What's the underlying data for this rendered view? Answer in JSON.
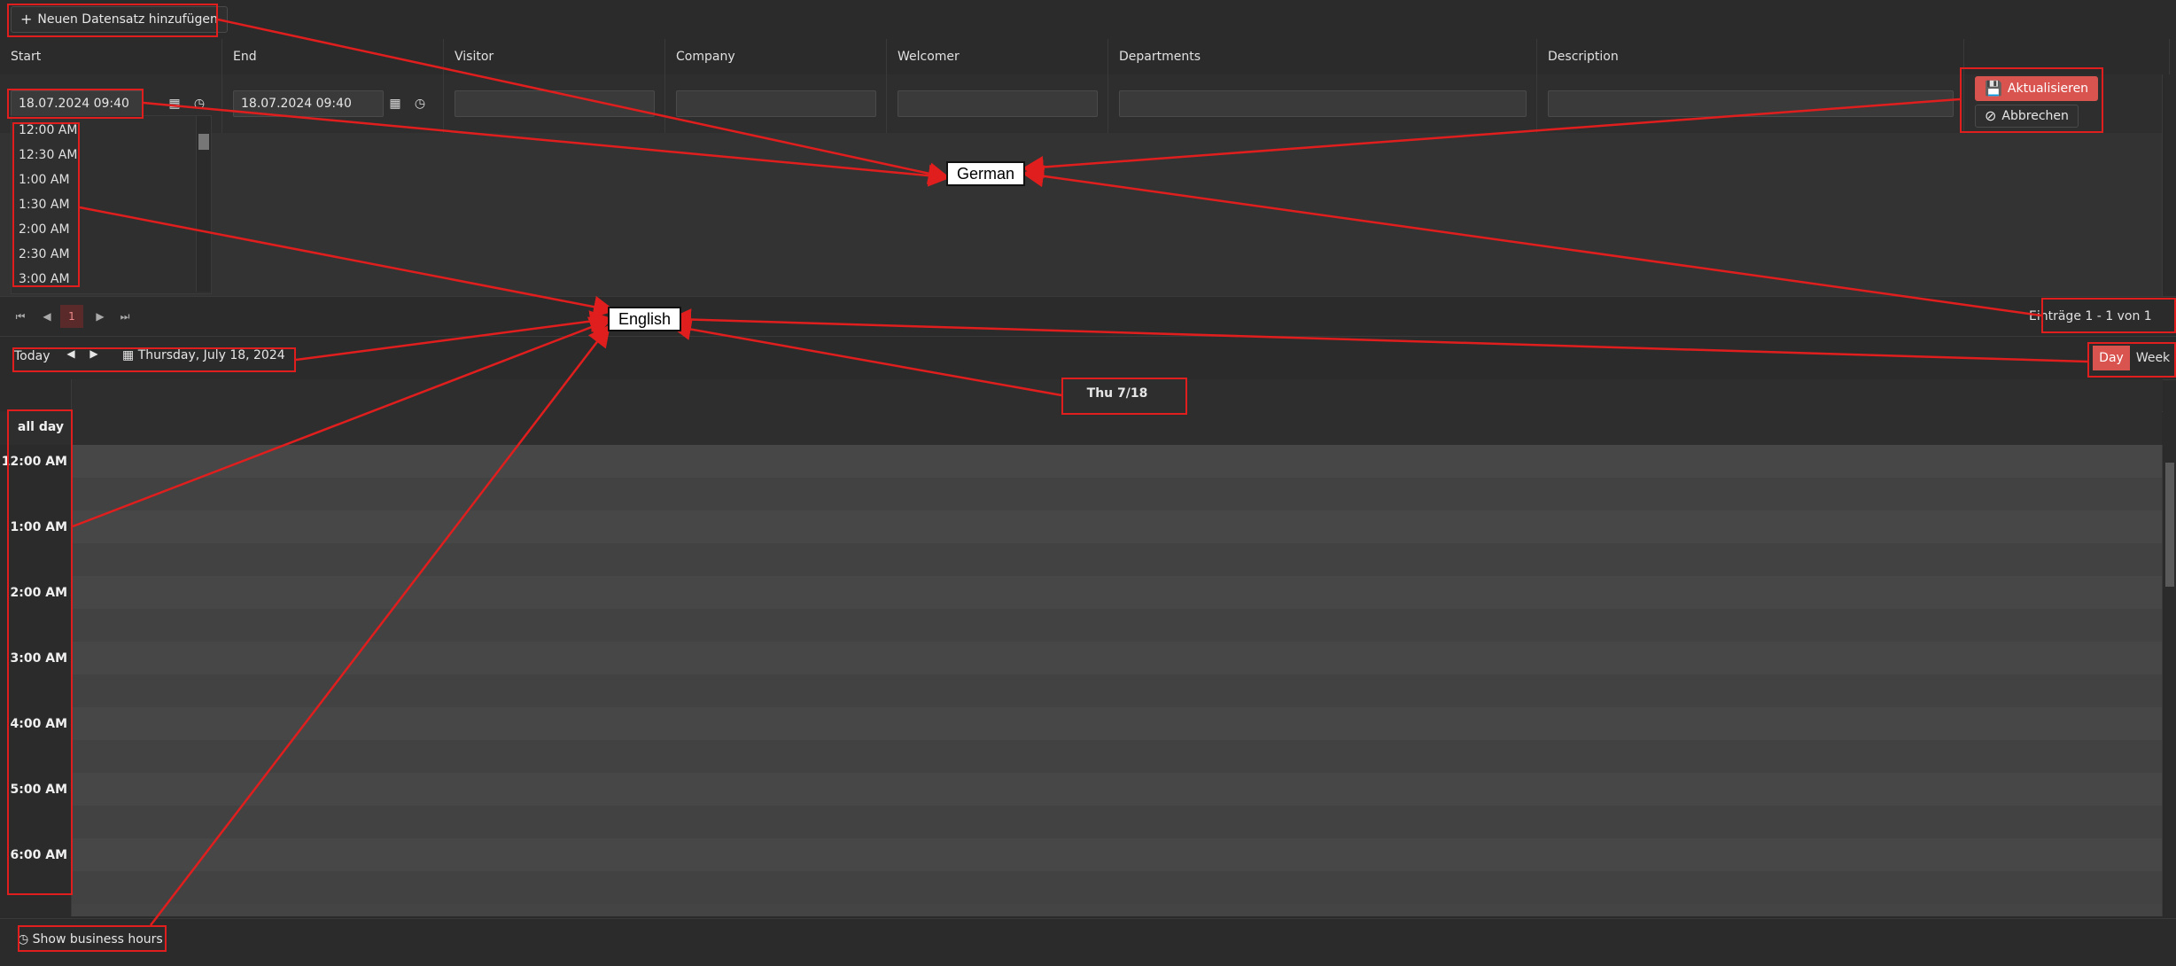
{
  "toolbar": {
    "add_label": "Neuen Datensatz hinzufügen"
  },
  "grid": {
    "columns": [
      "Start",
      "End",
      "Visitor",
      "Company",
      "Welcomer",
      "Departments",
      "Description"
    ],
    "edit_row": {
      "start_value": "18.07.2024 09:40",
      "end_value": "18.07.2024 09:40",
      "update_label": "Aktualisieren",
      "cancel_label": "Abbrechen"
    },
    "time_options": [
      "12:00 AM",
      "12:30 AM",
      "1:00 AM",
      "1:30 AM",
      "2:00 AM",
      "2:30 AM",
      "3:00 AM"
    ],
    "pager": {
      "current_page": "1",
      "summary": "Einträge 1 - 1 von 1"
    }
  },
  "scheduler": {
    "today_label": "Today",
    "date_label": "Thursday, July 18, 2024",
    "views": [
      "Day",
      "Week"
    ],
    "day_header": "Thu 7/18",
    "all_day_label": "all day",
    "hours": [
      "12:00 AM",
      "1:00 AM",
      "2:00 AM",
      "3:00 AM",
      "4:00 AM",
      "5:00 AM",
      "6:00 AM"
    ],
    "business_hours_label": "Show business hours"
  },
  "annotations": {
    "german": "German",
    "english": "English"
  },
  "colors": {
    "accent": "#d9534f",
    "annotation": "#e01e1e",
    "background": "#2b2b2b"
  }
}
